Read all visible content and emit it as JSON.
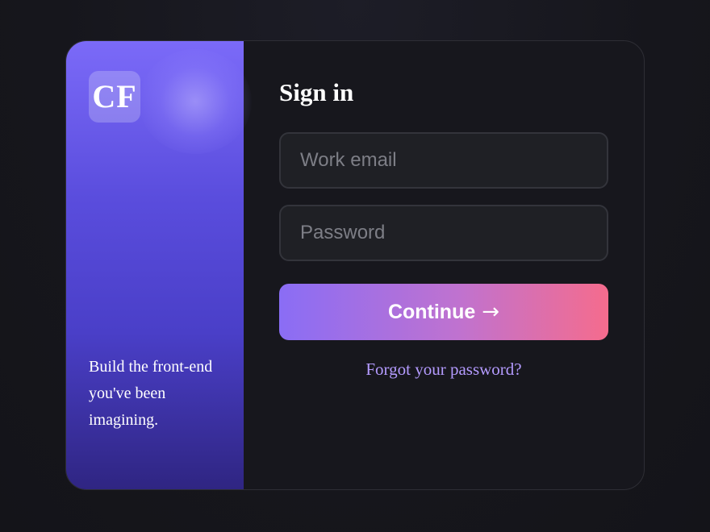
{
  "brand": {
    "logo_text": "CF",
    "tagline_line1": "Build the front-end",
    "tagline_line2": "you've been imagining."
  },
  "form": {
    "title": "Sign in",
    "email": {
      "value": "",
      "placeholder": "Work email"
    },
    "password": {
      "value": "",
      "placeholder": "Password"
    },
    "submit_label": "Continue",
    "submit_icon": "→",
    "forgot_label": "Forgot your password?"
  },
  "colors": {
    "accent_start": "#8a6df5",
    "accent_end": "#f56c8d",
    "brand_panel": "#5a4ddd",
    "link": "#b49bff",
    "background": "#17171d"
  },
  "icons": {
    "submit_arrow": "arrow-right-icon"
  }
}
